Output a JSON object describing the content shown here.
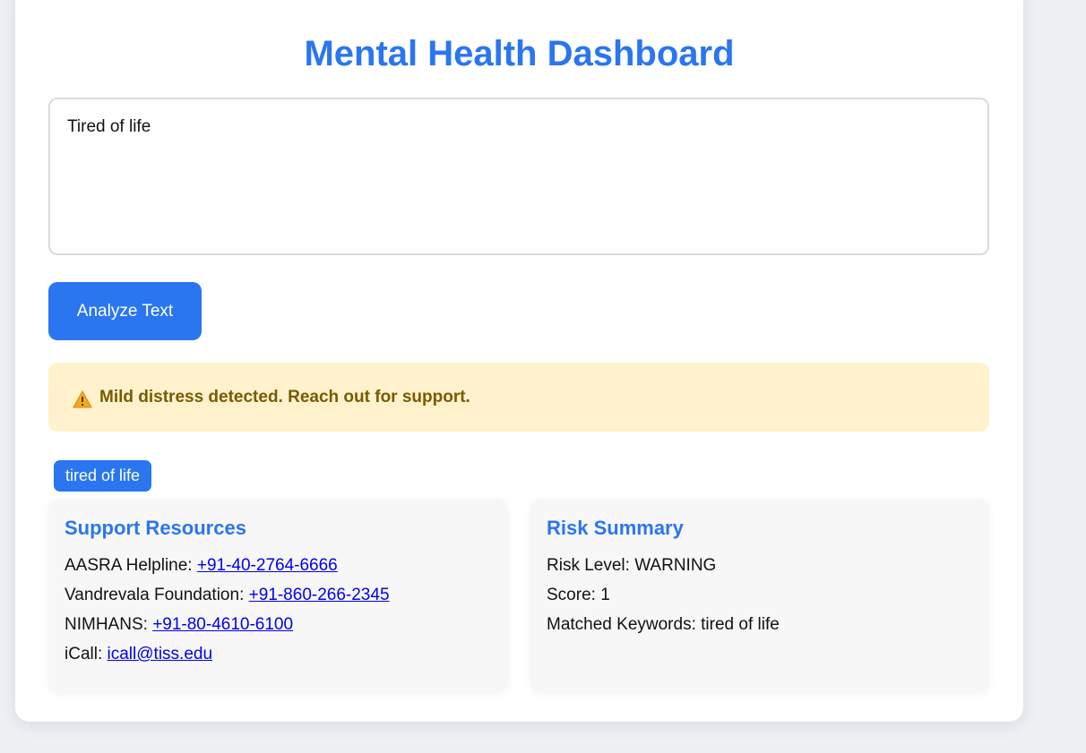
{
  "header": {
    "title": "Mental Health Dashboard"
  },
  "input": {
    "value": "Tired of life",
    "placeholder": ""
  },
  "analyze_button": {
    "label": "Analyze Text"
  },
  "alert": {
    "icon": "warning-icon",
    "message": "Mild distress detected. Reach out for support."
  },
  "tags": [
    {
      "label": "tired of life"
    }
  ],
  "support": {
    "heading": "Support Resources",
    "items": [
      {
        "label": "AASRA Helpline:",
        "link": "+91-40-2764-6666"
      },
      {
        "label": "Vandrevala Foundation:",
        "link": "+91-860-266-2345"
      },
      {
        "label": "NIMHANS:",
        "link": "+91-80-4610-6100"
      },
      {
        "label": "iCall:",
        "link": "icall@tiss.edu"
      }
    ]
  },
  "risk": {
    "heading": "Risk Summary",
    "items": [
      {
        "text": "Risk Level: WARNING"
      },
      {
        "text": "Score: 1"
      },
      {
        "text": "Matched Keywords: tired of life"
      }
    ]
  },
  "colors": {
    "accent": "#2a76f0",
    "alert_bg": "#fff2cc",
    "alert_text": "#7a5a00",
    "link": "#0000ee"
  }
}
